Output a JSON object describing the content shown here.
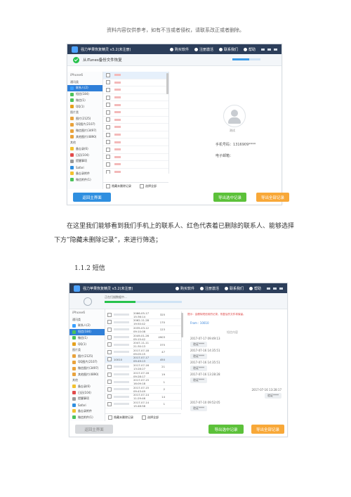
{
  "header_note": "资料内容仅供参考，如有不当或者侵权，请联系改正或者删除。",
  "app": {
    "title": "强力苹果恢复精灵 v3.2(未注册)",
    "top_buttons": [
      "购买软件",
      "注册激活",
      "联系我们",
      "帮助"
    ]
  },
  "shot1": {
    "sub_title": "从iTunes备份文件恢复",
    "device": "iPhone6",
    "sidebar": [
      {
        "group": "通讯类"
      },
      {
        "label": "联系人(2)",
        "selected": true,
        "color": "#3aa0ff"
      },
      {
        "label": "短信(184)",
        "color": "#4cc35b"
      },
      {
        "label": "微信(1)",
        "color": "#4cc35b"
      },
      {
        "label": "QQ(1)",
        "color": "#e5a11d"
      },
      {
        "group": "图片类"
      },
      {
        "label": "图片(2125)",
        "color": "#e9a23b"
      },
      {
        "label": "QQ图片(2107)",
        "color": "#e9a23b"
      },
      {
        "label": "微信图片(3497)",
        "color": "#e9a23b"
      },
      {
        "label": "其他图片(4890)",
        "color": "#e9a23b"
      },
      {
        "group": "其他"
      },
      {
        "label": "备忘录(6)",
        "color": "#f2c12e"
      },
      {
        "label": "日历(104)",
        "color": "#e24b4b"
      },
      {
        "label": "提醒事项",
        "color": "#999999"
      },
      {
        "label": "Safari",
        "color": "#2f8fe0"
      },
      {
        "label": "备忘录附件",
        "color": "#f2c12e"
      },
      {
        "label": "微信附件(1)",
        "color": "#4cc35b"
      }
    ],
    "list_footer": [
      "隐藏未删除记录",
      "选择全部"
    ],
    "detail": {
      "phone_label": "手机号码：",
      "phone": "1316909****",
      "email_label": "电子邮箱：",
      "name": "测试"
    },
    "buttons": {
      "back": "返回主界面",
      "export_selected": "导出选中记录",
      "export_all": "导出全部记录"
    }
  },
  "paragraph": "在这里我们能够看到我们手机上的联系人、红色代表着已删除的联系人、能够选择下方”隐藏未删除记录”，来进行筛选；",
  "section_heading": "1.1.2 短信",
  "shot2": {
    "device": "iPhone6",
    "status_text": "正在扫描数据中...",
    "progress": 0.4,
    "sidebar": [
      {
        "group": "通讯类"
      },
      {
        "label": "联系人(2)",
        "color": "#3aa0ff"
      },
      {
        "label": "短信(184)",
        "selected": true,
        "color": "#4cc35b"
      },
      {
        "label": "微信(1)",
        "color": "#4cc35b"
      },
      {
        "label": "QQ(1)",
        "color": "#e5a11d"
      },
      {
        "group": "图片类"
      },
      {
        "label": "图片(2125)",
        "color": "#e9a23b"
      },
      {
        "label": "QQ图片(2107)",
        "color": "#e9a23b"
      },
      {
        "label": "微信图片(3497)",
        "color": "#e9a23b"
      },
      {
        "label": "其他图片(4890)",
        "color": "#e9a23b"
      },
      {
        "group": "其他"
      },
      {
        "label": "备忘录(6)",
        "color": "#f2c12e"
      },
      {
        "label": "日历(104)",
        "color": "#e24b4b"
      },
      {
        "label": "提醒事项",
        "color": "#999999"
      },
      {
        "label": "Safari",
        "color": "#2f8fe0"
      },
      {
        "label": "备忘录附件",
        "color": "#f2c12e"
      },
      {
        "label": "微信附件(1)",
        "color": "#4cc35b"
      }
    ],
    "messages": [
      {
        "date": "2066-05-17 15:36:14",
        "count": "325"
      },
      {
        "date": "2062-11-28 19:50:42",
        "count": "170"
      },
      {
        "date": "2035-03-12 09:10:08",
        "count": "123"
      },
      {
        "date": "2049-01-26 05:15:42",
        "count": "4903"
      },
      {
        "date": "2047-11-11 21:30:13",
        "count": "375"
      },
      {
        "date": "2017-07-18 09:05:15",
        "count": "47"
      },
      {
        "date": "2017-07-17 09:49:13",
        "count": "450",
        "highlight": true,
        "name": "10010"
      },
      {
        "date": "2017-07-16 13:28:27",
        "count": "21"
      },
      {
        "date": "2017-07-16 09:28:17",
        "count": "19"
      },
      {
        "date": "2017-07-15 16:09:18",
        "count": "1"
      },
      {
        "date": "2017-07-15 09:43:49",
        "count": "2"
      },
      {
        "date": "2017-07-14 11:29:46",
        "count": "14"
      },
      {
        "date": "2017-07-14 15:48:58",
        "count": "1"
      }
    ],
    "thread": {
      "warning": "提示：会删除短信前的记录，恢复后的文件将保留。",
      "from": "From : 10010",
      "section": "短信内容",
      "items": [
        {
          "time": "2017-07-17 09:49:13",
          "text": "验证****",
          "side": "left"
        },
        {
          "time": "2017-07-16 14:35:51",
          "text": "验证****",
          "side": "left"
        },
        {
          "time": "2017-07-16 14:35:51",
          "text": "验证****",
          "side": "left"
        },
        {
          "time": "2017-07-16 13:28:28",
          "text": "验证****",
          "side": "left"
        },
        {
          "time": "2017-07-16 13:28:17",
          "text": "验证****",
          "side": "right"
        },
        {
          "time": "2017-07-10 09:52:05",
          "text": "验证****",
          "side": "left"
        }
      ]
    },
    "list_footer": [
      "隐藏未删除记录",
      "选择全部"
    ],
    "buttons": {
      "back": "返回主界面",
      "export_selected": "导出选中记录",
      "export_all": "导出全部记录"
    }
  }
}
